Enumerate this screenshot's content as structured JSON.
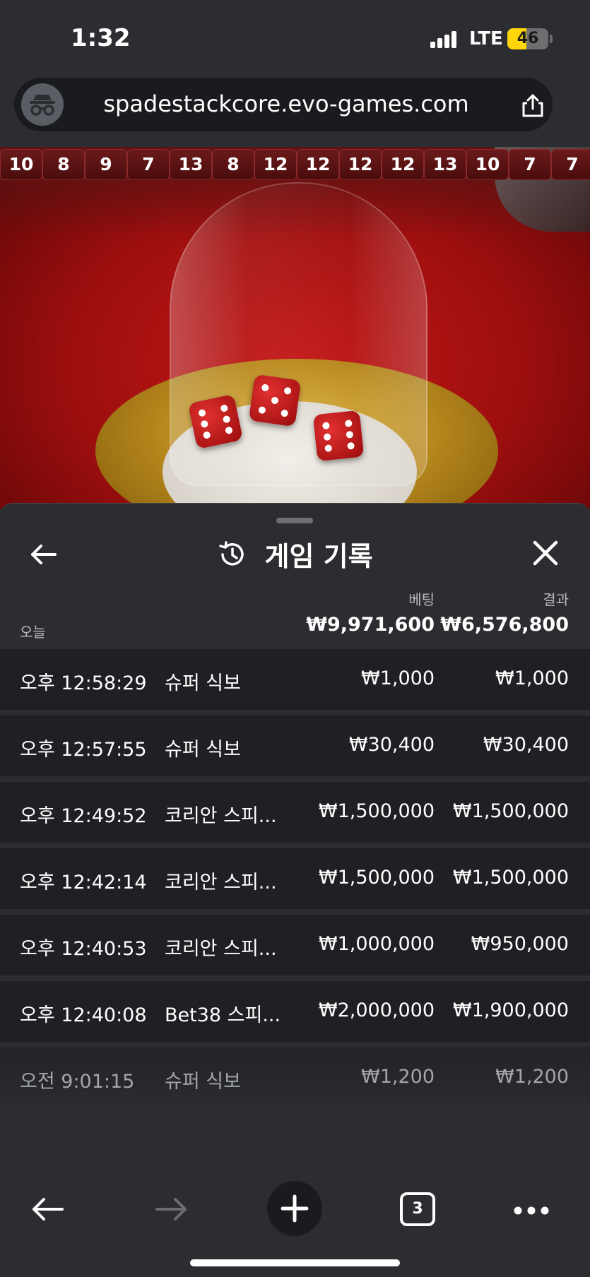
{
  "status_bar": {
    "time": "1:32",
    "network": "LTE",
    "battery": "46",
    "battery_level": 0.46
  },
  "browser": {
    "url": "spadestackcore.evo-games.com"
  },
  "game": {
    "history": [
      "10",
      "8",
      "9",
      "7",
      "13",
      "8",
      "12",
      "12",
      "12",
      "12",
      "13",
      "10",
      "7",
      "7"
    ]
  },
  "sheet": {
    "title": "게임 기록",
    "col_bet": "베팅",
    "col_result": "결과",
    "today_label": "오늘",
    "total_bet": "₩9,971,600",
    "total_result": "₩6,576,800",
    "rows": [
      {
        "time": "오후 12:58:29",
        "game": "슈퍼 식보",
        "bet": "₩1,000",
        "result": "₩1,000"
      },
      {
        "time": "오후 12:57:55",
        "game": "슈퍼 식보",
        "bet": "₩30,400",
        "result": "₩30,400"
      },
      {
        "time": "오후 12:49:52",
        "game": "코리안 스피...",
        "bet": "₩1,500,000",
        "result": "₩1,500,000"
      },
      {
        "time": "오후 12:42:14",
        "game": "코리안 스피...",
        "bet": "₩1,500,000",
        "result": "₩1,500,000"
      },
      {
        "time": "오후 12:40:53",
        "game": "코리안 스피...",
        "bet": "₩1,000,000",
        "result": "₩950,000"
      },
      {
        "time": "오후 12:40:08",
        "game": "Bet38 스피...",
        "bet": "₩2,000,000",
        "result": "₩1,900,000"
      },
      {
        "time": "오전 9:01:15",
        "game": "슈퍼 식보",
        "bet": "₩1,200",
        "result": "₩1,200"
      }
    ]
  },
  "toolbar": {
    "tab_count": "3"
  },
  "colors": {
    "background": "#2b2d31",
    "row": "#1f2024",
    "battery": "#ffd60a",
    "table_felt": "#c41818"
  },
  "icons": [
    "incognito-icon",
    "share-icon",
    "back-arrow-icon",
    "history-icon",
    "close-icon",
    "forward-arrow-icon",
    "plus-icon",
    "more-icon"
  ]
}
